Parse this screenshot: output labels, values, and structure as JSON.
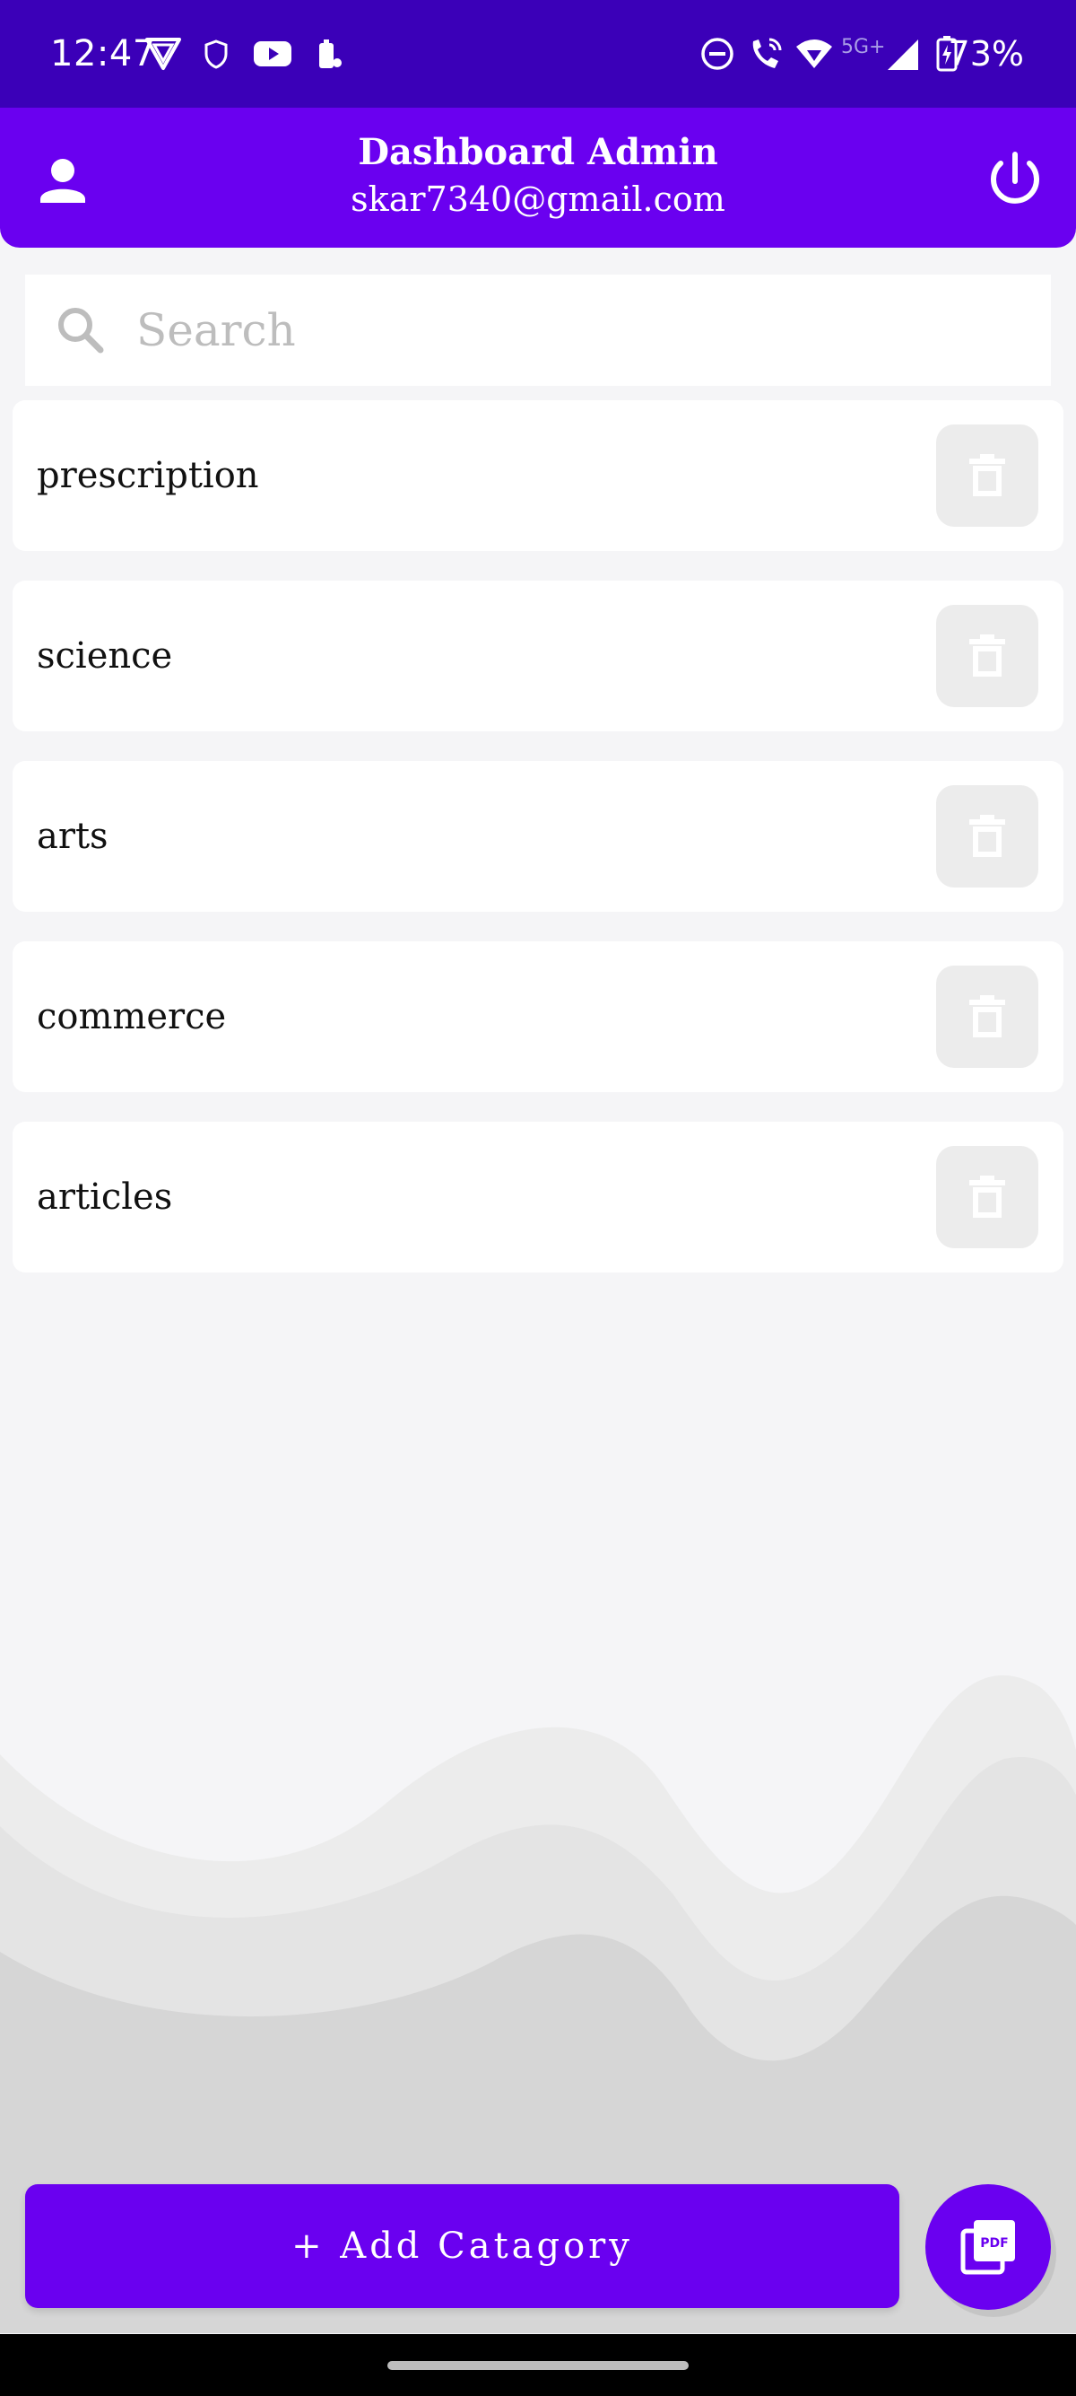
{
  "status_bar": {
    "time": "12:47",
    "network": "5G+",
    "battery": "73%",
    "left_icons": [
      "vpn-icon",
      "shield-icon",
      "youtube-icon",
      "battery-saver-icon"
    ],
    "right_icons": [
      "do-not-disturb-icon",
      "wifi-calling-icon",
      "wifi-icon",
      "signal-icon",
      "battery-charging-icon"
    ]
  },
  "header": {
    "title": "Dashboard Admin",
    "email": "skar7340@gmail.com",
    "left_icon": "person-icon",
    "right_icon": "power-icon",
    "color": "#6a00f0"
  },
  "search": {
    "placeholder": "Search",
    "value": ""
  },
  "categories": [
    {
      "label": "prescription"
    },
    {
      "label": "science"
    },
    {
      "label": "arts"
    },
    {
      "label": "commerce"
    },
    {
      "label": "articles"
    }
  ],
  "actions": {
    "add_label": "+ Add Catagory",
    "fab_icon": "pdf-icon"
  },
  "colors": {
    "status_bar": "#3b00b8",
    "accent": "#6a00f0",
    "background": "#f5f5f7"
  }
}
